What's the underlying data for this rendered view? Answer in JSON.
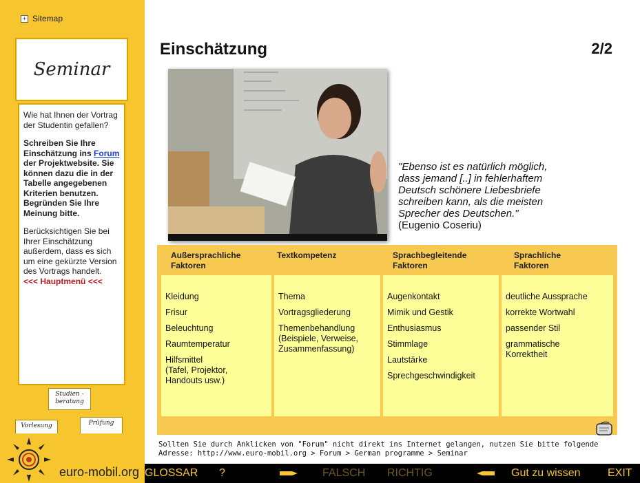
{
  "sidebar": {
    "sitemap": "Sitemap",
    "seminar_title": "Seminar",
    "q1": "Wie hat Ihnen der Vortrag der Studentin gefallen?",
    "q2_a": "Schreiben Sie Ihre Einschätzung ins",
    "q2_link": "Forum",
    "q2_b": "der Projektwebsite.  Sie können dazu die in der Tabelle angegebenen Kriterien benutzen. Begründen Sie Ihre Meinung bitte.",
    "q3": "Berücksichtigen Sie bei Ihrer Einschätzung außerdem, dass es sich um eine gekürzte Version des Vortrags handelt.",
    "hauptmenu": "<<< Hauptmenü <<<",
    "btn_studien_1": "Studien -",
    "btn_studien_2": "beratung",
    "btn_vorlesung": "Vorlesung",
    "btn_pruefung": "Prüfung",
    "logo_text": "euro-mobil.org"
  },
  "main": {
    "title": "Einschätzung",
    "page": "2/2",
    "quote_lines": [
      "\"Ebenso ist es natürlich möglich,",
      "dass jemand [..] in fehlerhaftem",
      "Deutsch schönere Liebesbriefe",
      "schreiben kann, als die meisten",
      "Sprecher des Deutschen.\""
    ],
    "quote_author": "(Eugenio Coseriu)"
  },
  "table": {
    "columns": [
      {
        "head": [
          "Außersprachliche",
          "Faktoren"
        ],
        "items": [
          "Kleidung",
          "Frisur",
          "Beleuchtung",
          "Raumtemperatur",
          "Hilfsmittel\n(Tafel, Projektor,\n Handouts usw.)"
        ]
      },
      {
        "head": [
          "Textkompetenz",
          ""
        ],
        "items": [
          "Thema",
          "Vortragsgliederung",
          "Themenbehandlung\n(Beispiele, Verweise,\n Zusammenfassung)"
        ]
      },
      {
        "head": [
          "Sprachbegleitende",
          "Faktoren"
        ],
        "items": [
          "Augenkontakt",
          "Mimik und Gestik",
          "Enthusiasmus",
          "Stimmlage",
          "Lautstärke",
          "Sprechgeschwindigkeit"
        ]
      },
      {
        "head": [
          "Sprachliche",
          "Faktoren"
        ],
        "items": [
          "deutliche Aussprache",
          "korrekte Wortwahl",
          "passender Stil",
          "grammatische\nKorrektheit"
        ]
      }
    ]
  },
  "footnote": {
    "line1": "Sollten Sie durch Anklicken von \"Forum\" nicht direkt ins Internet gelangen, nutzen Sie bitte folgende",
    "line2": "Adresse: http://www.euro-mobil.org > Forum > German programme > Seminar"
  },
  "bottom_bar": {
    "glossar": "GLOSSAR",
    "help": "?",
    "falsch": "FALSCH",
    "richtig": "RICHTIG",
    "gut": "Gut zu wissen",
    "exit": "EXIT"
  },
  "colors": {
    "sidebar_bg": "#f7c62f",
    "table_bg": "#f7c951",
    "cell_bg": "#ffff99",
    "bar_bg": "#000000",
    "bar_active": "#f7c62f",
    "bar_inactive": "#6e5a1e"
  }
}
